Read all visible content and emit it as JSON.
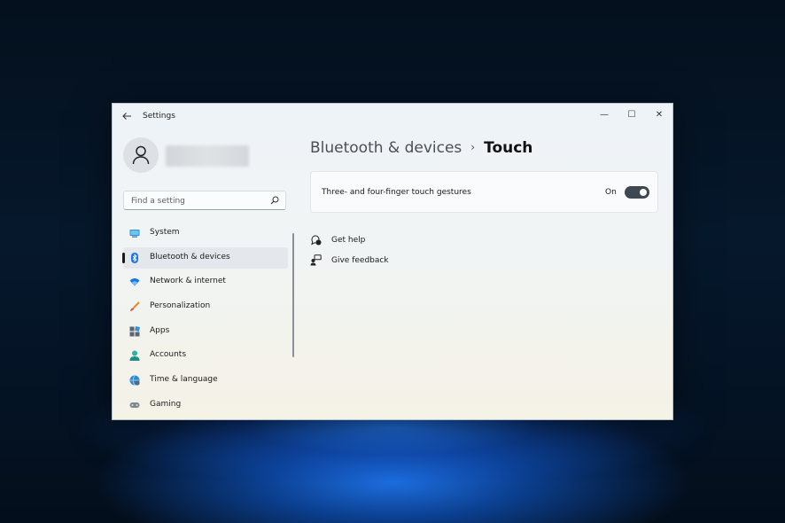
{
  "window": {
    "title": "Settings",
    "back_icon": "arrow-left-icon",
    "controls": {
      "minimize": "—",
      "maximize": "☐",
      "close": "✕"
    }
  },
  "user": {
    "avatar_icon": "person-icon"
  },
  "search": {
    "placeholder": "Find a setting",
    "icon": "search-icon"
  },
  "nav": {
    "active": "Bluetooth & devices",
    "items": [
      {
        "label": "System",
        "icon": "system-monitor-icon"
      },
      {
        "label": "Bluetooth & devices",
        "icon": "bluetooth-icon"
      },
      {
        "label": "Network & internet",
        "icon": "wifi-icon"
      },
      {
        "label": "Personalization",
        "icon": "brush-icon"
      },
      {
        "label": "Apps",
        "icon": "apps-icon"
      },
      {
        "label": "Accounts",
        "icon": "accounts-icon"
      },
      {
        "label": "Time & language",
        "icon": "globe-clock-icon"
      },
      {
        "label": "Gaming",
        "icon": "gamepad-icon"
      }
    ]
  },
  "main": {
    "breadcrumb_parent": "Bluetooth & devices",
    "breadcrumb_separator": "›",
    "breadcrumb_current": "Touch",
    "setting": {
      "label": "Three- and four-finger touch gestures",
      "state_label": "On",
      "enabled": true
    },
    "links": [
      {
        "label": "Get help",
        "icon": "help-icon"
      },
      {
        "label": "Give feedback",
        "icon": "feedback-icon"
      }
    ]
  },
  "colors": {
    "accent_blue": "#1a73e8",
    "toggle_on": "#3e4852",
    "background_dark": "#06182c"
  }
}
